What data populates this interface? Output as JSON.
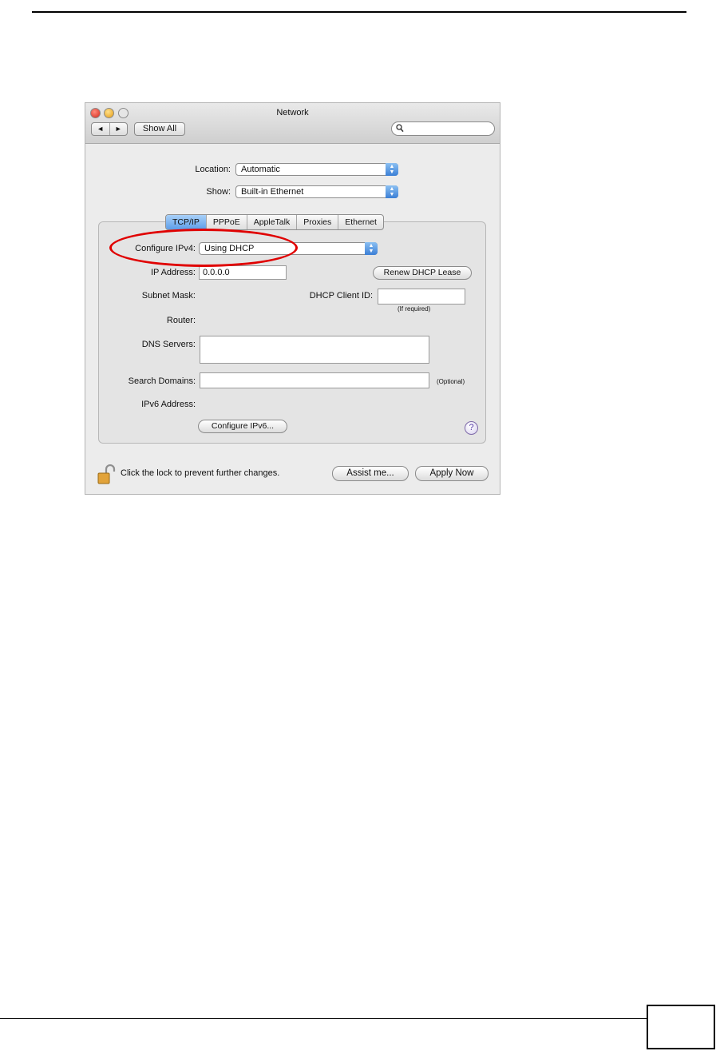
{
  "window": {
    "title": "Network",
    "nav_back": "◄",
    "nav_forward": "►",
    "show_all_label": "Show All",
    "search_placeholder": ""
  },
  "location": {
    "label": "Location:",
    "value": "Automatic"
  },
  "show": {
    "label": "Show:",
    "value": "Built-in Ethernet"
  },
  "tabs": [
    {
      "label": "TCP/IP",
      "active": true
    },
    {
      "label": "PPPoE",
      "active": false
    },
    {
      "label": "AppleTalk",
      "active": false
    },
    {
      "label": "Proxies",
      "active": false
    },
    {
      "label": "Ethernet",
      "active": false
    }
  ],
  "tcpip": {
    "configure_ipv4_label": "Configure IPv4:",
    "configure_ipv4_value": "Using DHCP",
    "ip_address_label": "IP Address:",
    "ip_address_value": "0.0.0.0",
    "renew_button": "Renew DHCP Lease",
    "subnet_mask_label": "Subnet Mask:",
    "dhcp_client_id_label": "DHCP Client ID:",
    "dhcp_client_id_value": "",
    "if_required": "(If required)",
    "router_label": "Router:",
    "dns_servers_label": "DNS Servers:",
    "dns_servers_value": "",
    "search_domains_label": "Search Domains:",
    "search_domains_value": "",
    "optional": "(Optional)",
    "ipv6_address_label": "IPv6 Address:",
    "configure_ipv6_button": "Configure IPv6...",
    "help_glyph": "?"
  },
  "footer": {
    "lock_text": "Click the lock to prevent further changes.",
    "assist_button": "Assist me...",
    "apply_button": "Apply Now"
  },
  "colors": {
    "callout": "#e00000",
    "tab_active": "#5d9ee9"
  },
  "icons": [
    "search-icon",
    "lock-icon",
    "help-icon",
    "popup-arrows-icon"
  ]
}
